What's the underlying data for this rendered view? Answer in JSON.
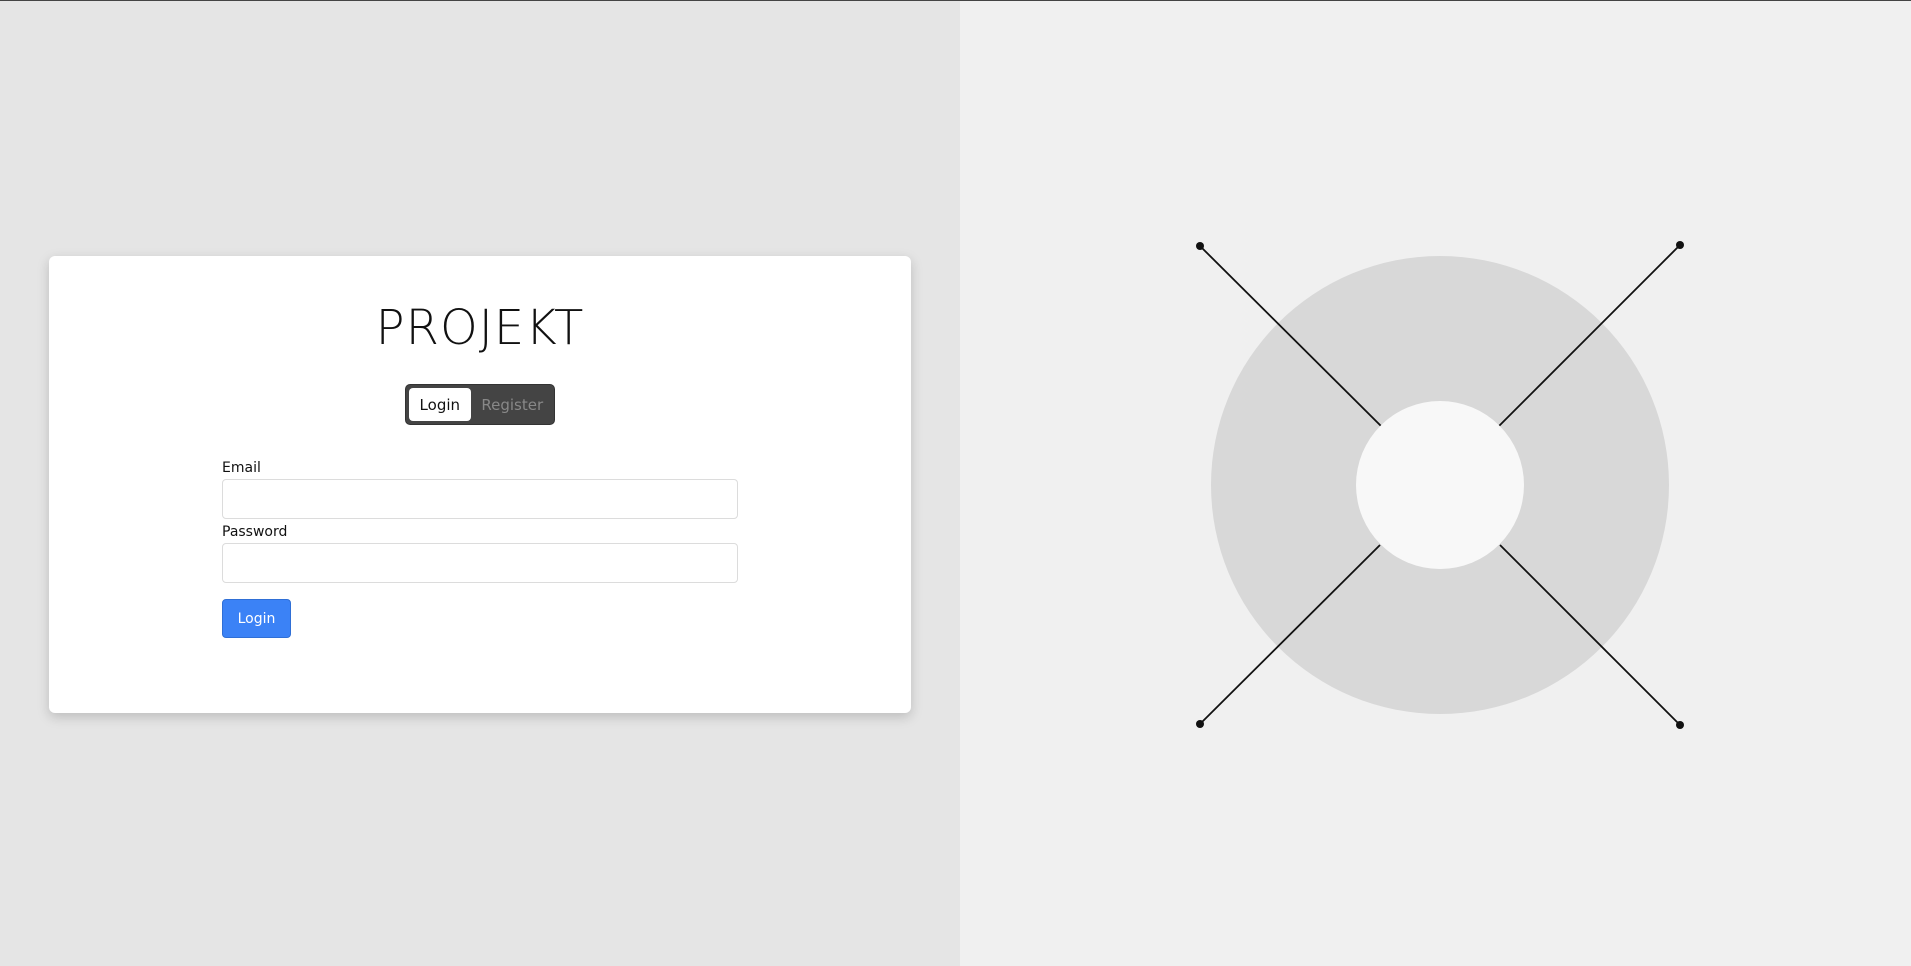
{
  "brand": {
    "title": "PROJEKT"
  },
  "auth_mode_toggle": {
    "tabs": [
      {
        "label": "Login",
        "active": true
      },
      {
        "label": "Register",
        "active": false
      }
    ]
  },
  "form": {
    "email_label": "Email",
    "email_value": "",
    "password_label": "Password",
    "password_value": "",
    "submit_label": "Login"
  },
  "colors": {
    "accent": "#3b82f6",
    "left_background": "#e5e5e5",
    "right_background": "#f0f0f0",
    "toggle_background": "#444444"
  },
  "illustration": {
    "type": "decorative-radial-graphic",
    "icon": "target-rays-illustration"
  }
}
